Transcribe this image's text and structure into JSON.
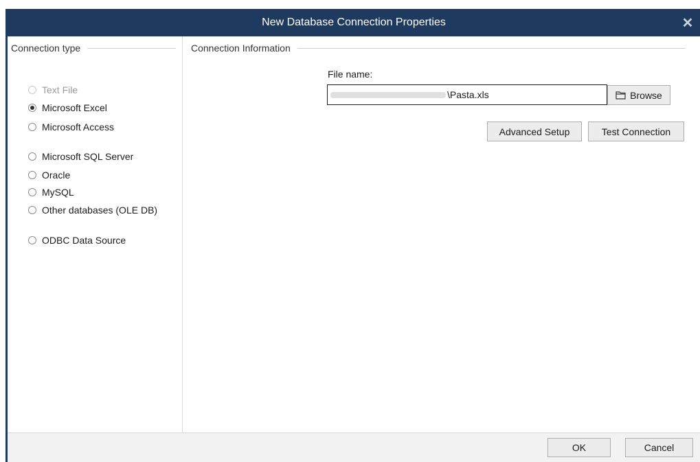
{
  "window": {
    "title": "New Database Connection Properties",
    "close_glyph": "✕"
  },
  "connection_type": {
    "header": "Connection type",
    "options": [
      {
        "label": "Text File",
        "state": "disabled"
      },
      {
        "label": "Microsoft Excel",
        "state": "checked"
      },
      {
        "label": "Microsoft Access",
        "state": "normal"
      },
      {
        "label": "Microsoft SQL Server",
        "state": "normal"
      },
      {
        "label": "Oracle",
        "state": "normal"
      },
      {
        "label": "MySQL",
        "state": "normal"
      },
      {
        "label": "Other databases (OLE DB)",
        "state": "normal"
      },
      {
        "label": "ODBC Data Source",
        "state": "normal"
      }
    ]
  },
  "connection_info": {
    "header": "Connection Information",
    "file_name_label": "File name:",
    "file_name_value": "\\Pasta.xls",
    "browse_label": "Browse",
    "browse_icon": "folder-icon",
    "advanced_setup_label": "Advanced Setup",
    "test_connection_label": "Test Connection"
  },
  "footer": {
    "ok_label": "OK",
    "cancel_label": "Cancel"
  },
  "colors": {
    "titlebar": "#1f3a5f",
    "footer": "#f2f2f2",
    "button": "#ececec"
  }
}
